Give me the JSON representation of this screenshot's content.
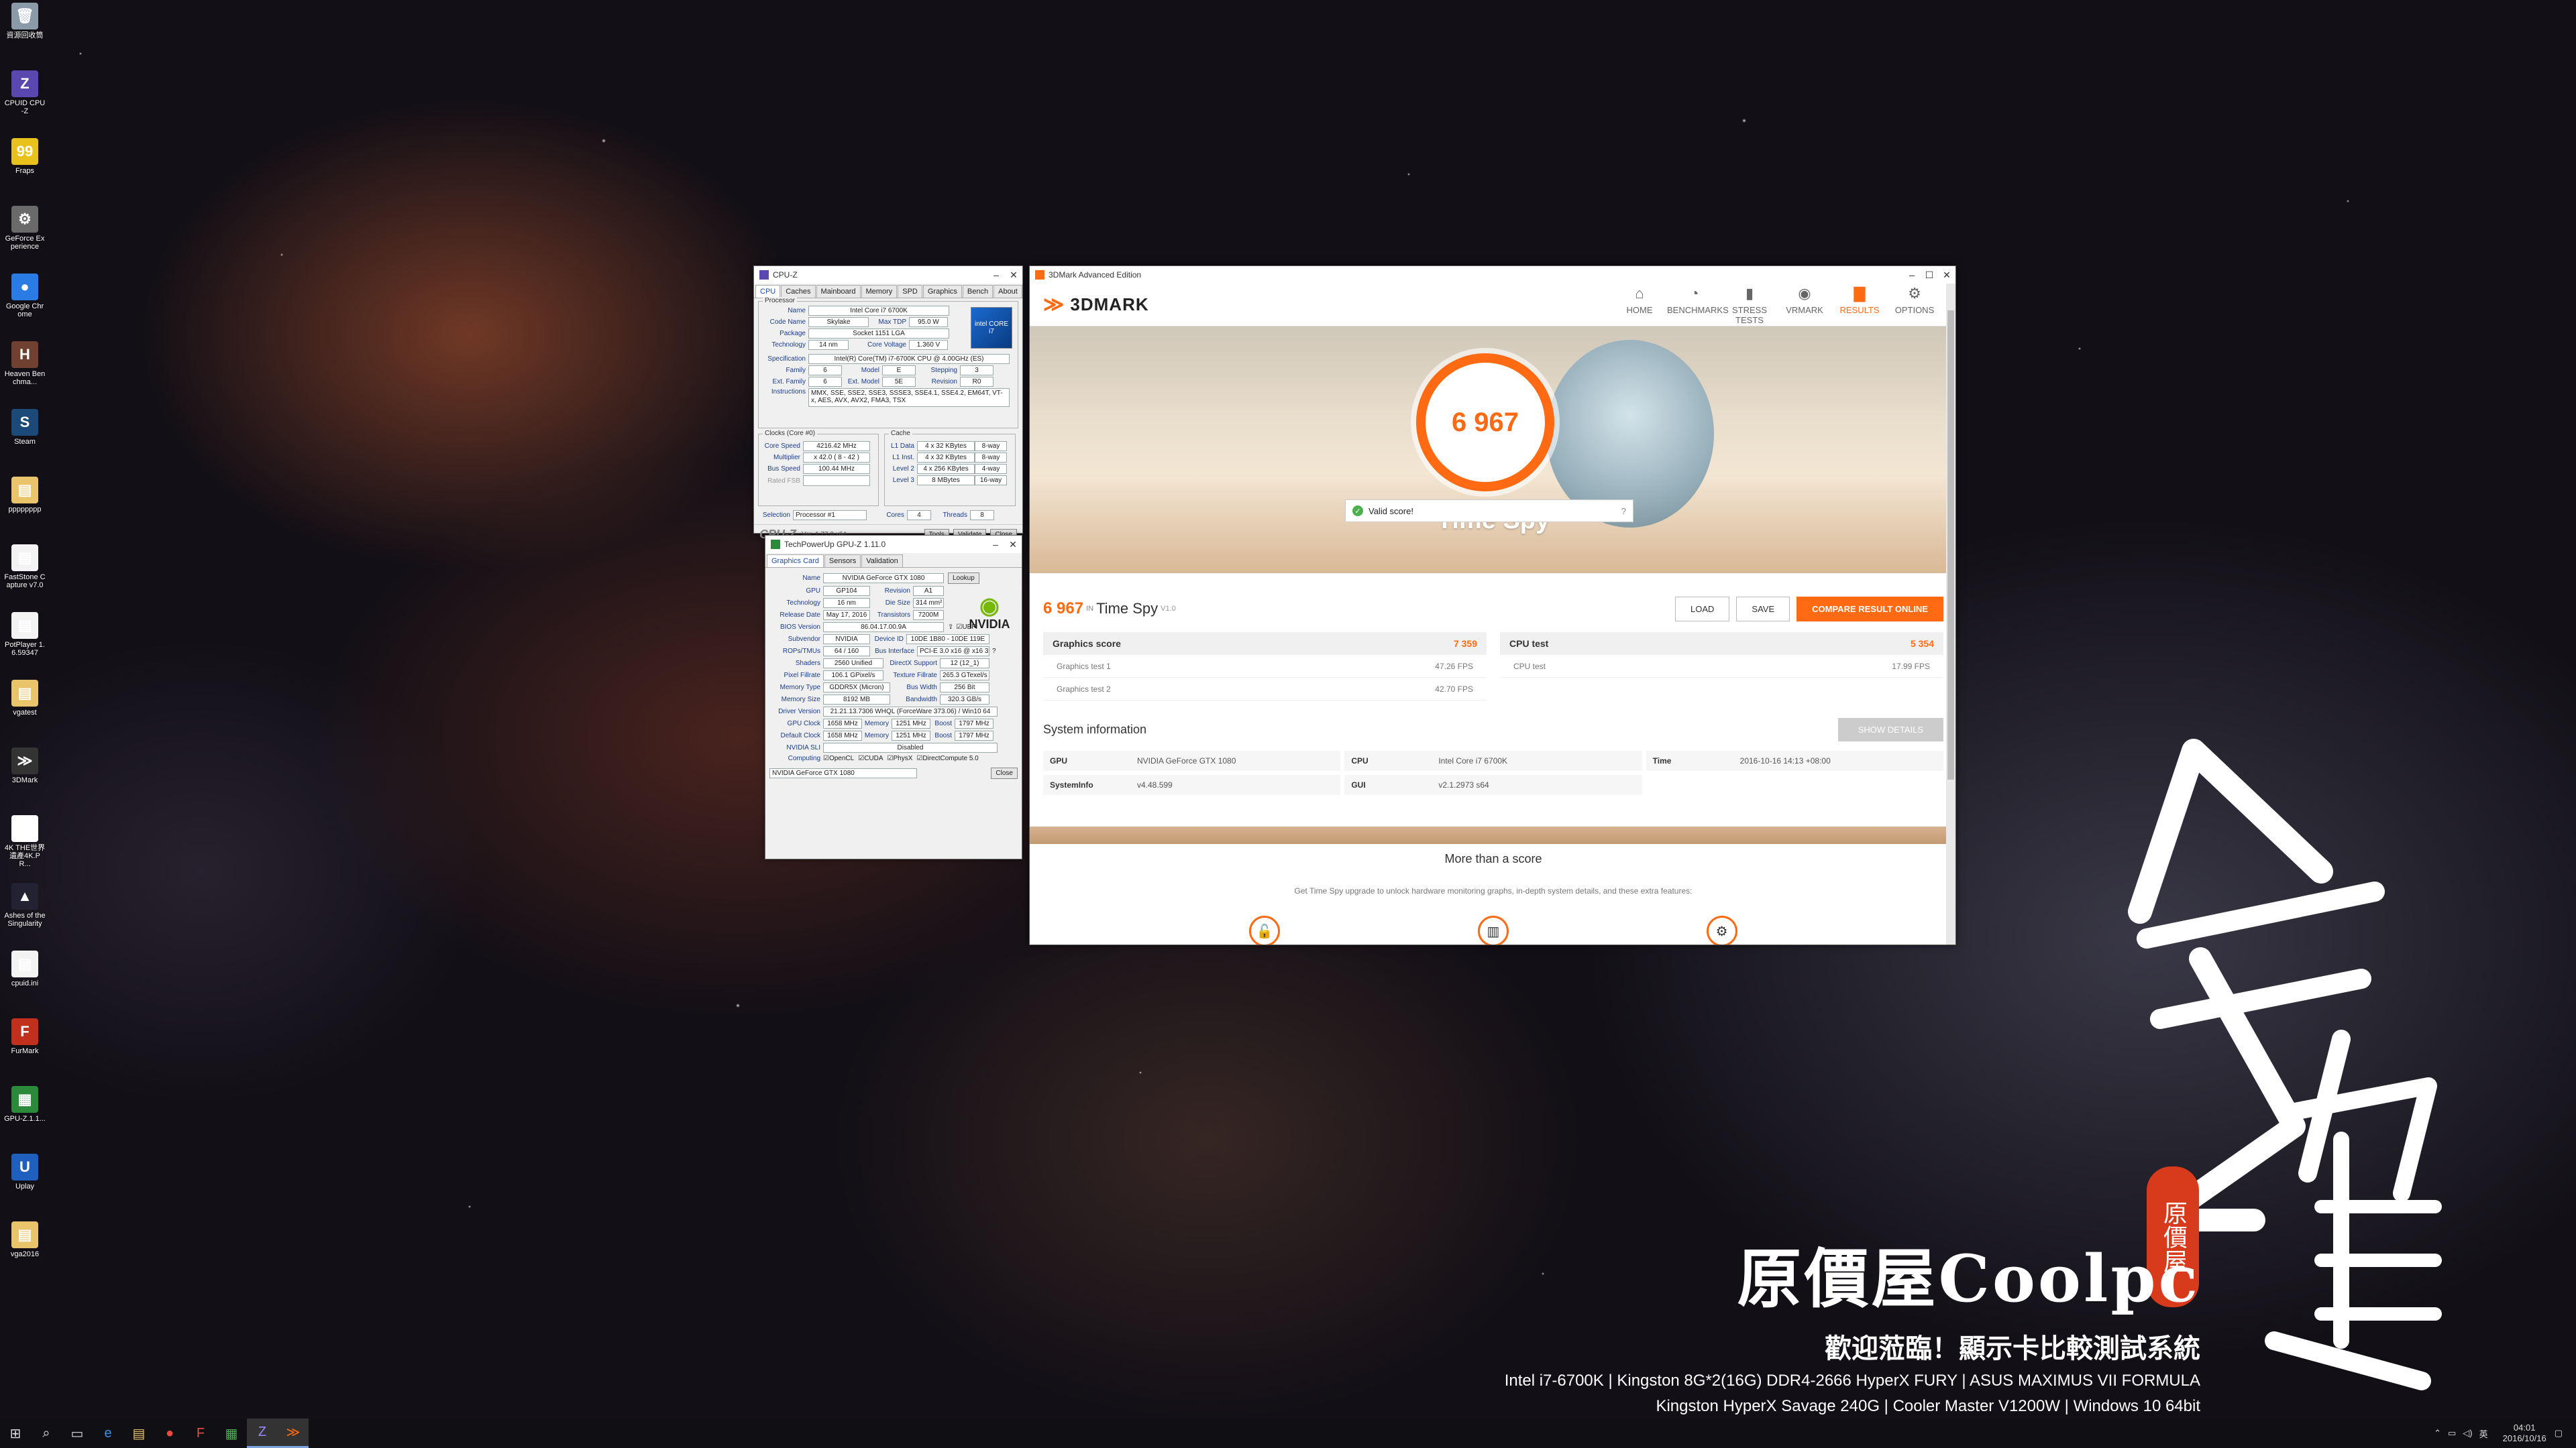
{
  "desktop_icons": [
    {
      "label": "資源回收筒",
      "icon": "recycle-bin-icon",
      "color": "#8a9aa8",
      "glyph": "🗑"
    },
    {
      "label": "CPUID CPU-Z",
      "icon": "cpuz-icon",
      "color": "#5a48b0",
      "glyph": "Z"
    },
    {
      "label": "Fraps",
      "icon": "fraps-icon",
      "color": "#e8c21a",
      "glyph": "99"
    },
    {
      "label": "GeForce Experience",
      "icon": "geforce-icon",
      "color": "#6a6a6a",
      "glyph": "⚙"
    },
    {
      "label": "Google Chrome",
      "icon": "chrome-icon",
      "color": "#2a7be4",
      "glyph": "●"
    },
    {
      "label": "Heaven Benchma...",
      "icon": "heaven-icon",
      "color": "#704030",
      "glyph": "H"
    },
    {
      "label": "Steam",
      "icon": "steam-icon",
      "color": "#1b4a78",
      "glyph": "S"
    },
    {
      "label": "pppppppp",
      "icon": "folder-icon",
      "color": "#e9c46a",
      "glyph": "▤"
    },
    {
      "label": "FastStone Capture v7.0",
      "icon": "file-icon",
      "color": "#f3f3f3",
      "glyph": "▤"
    },
    {
      "label": "PotPlayer 1.6.59347",
      "icon": "file-icon",
      "color": "#f3f3f3",
      "glyph": "▤"
    },
    {
      "label": "vgatest",
      "icon": "folder-icon",
      "color": "#e9c46a",
      "glyph": "▤"
    },
    {
      "label": "3DMark",
      "icon": "3dmark-icon",
      "color": "#333",
      "glyph": "≫"
    },
    {
      "label": "4K THE世界遺產4K.PR...",
      "icon": "document-icon",
      "color": "#ffffff",
      "glyph": "▤"
    },
    {
      "label": "Ashes of the Singularity",
      "icon": "ashes-icon",
      "color": "#223",
      "glyph": "▲"
    },
    {
      "label": "cpuid.ini",
      "icon": "file-icon",
      "color": "#f3f3f3",
      "glyph": "▤"
    },
    {
      "label": "FurMark",
      "icon": "furmark-icon",
      "color": "#c0301c",
      "glyph": "F"
    },
    {
      "label": "GPU-Z.1.1...",
      "icon": "gpuz-icon",
      "color": "#2a8a3a",
      "glyph": "▦"
    },
    {
      "label": "Uplay",
      "icon": "uplay-icon",
      "color": "#1f5fbd",
      "glyph": "U"
    },
    {
      "label": "vga2016",
      "icon": "folder-icon",
      "color": "#e9c46a",
      "glyph": "▤"
    }
  ],
  "cpuz": {
    "title": "CPU-Z",
    "tabs": [
      "CPU",
      "Caches",
      "Mainboard",
      "Memory",
      "SPD",
      "Graphics",
      "Bench",
      "About"
    ],
    "processor_label": "Processor",
    "name_label": "Name",
    "name": "Intel Core i7 6700K",
    "codename_label": "Code Name",
    "codename": "Skylake",
    "maxtdp_label": "Max TDP",
    "maxtdp": "95.0 W",
    "package_label": "Package",
    "package": "Socket 1151 LGA",
    "tech_label": "Technology",
    "tech": "14 nm",
    "corev_label": "Core Voltage",
    "corev": "1.360 V",
    "spec_label": "Specification",
    "spec": "Intel(R) Core(TM) i7-6700K CPU @ 4.00GHz (ES)",
    "family_label": "Family",
    "family": "6",
    "model_label": "Model",
    "model": "E",
    "stepping_label": "Stepping",
    "stepping": "3",
    "extfam_label": "Ext. Family",
    "extfam": "6",
    "extmodel_label": "Ext. Model",
    "extmodel": "5E",
    "revision_label": "Revision",
    "revision": "R0",
    "instr_label": "Instructions",
    "instr": "MMX, SSE, SSE2, SSE3, SSSE3, SSE4.1, SSE4.2, EM64T, VT-x, AES, AVX, AVX2, FMA3, TSX",
    "clocks_label": "Clocks (Core #0)",
    "cache_label": "Cache",
    "corespeed_label": "Core Speed",
    "corespeed": "4216.42 MHz",
    "l1d_label": "L1 Data",
    "l1d": "4 x 32 KBytes",
    "l1d_way": "8-way",
    "mult_label": "Multiplier",
    "mult": "x 42.0 ( 8 - 42 )",
    "l1i_label": "L1 Inst.",
    "l1i": "4 x 32 KBytes",
    "l1i_way": "8-way",
    "bus_label": "Bus Speed",
    "bus": "100.44 MHz",
    "l2_label": "Level 2",
    "l2": "4 x 256 KBytes",
    "l2_way": "4-way",
    "fsb_label": "Rated FSB",
    "l3_label": "Level 3",
    "l3": "8 MBytes",
    "l3_way": "16-way",
    "sel_label": "Selection",
    "sel": "Processor #1",
    "cores_label": "Cores",
    "cores": "4",
    "threads_label": "Threads",
    "threads": "8",
    "footer_brand": "CPU-Z",
    "version": "Ver. 1.77.0.x64",
    "tools": "Tools",
    "validate": "Validate",
    "close": "Close",
    "intel_badge": "intel CORE i7"
  },
  "gpuz": {
    "title": "TechPowerUp GPU-Z 1.11.0",
    "tabs": [
      "Graphics Card",
      "Sensors",
      "Validation"
    ],
    "name_label": "Name",
    "name": "NVIDIA GeForce GTX 1080",
    "lookup": "Lookup",
    "gpu_label": "GPU",
    "gpu": "GP104",
    "rev_label": "Revision",
    "rev": "A1",
    "tech_label": "Technology",
    "tech": "16 nm",
    "die_label": "Die Size",
    "die": "314 mm²",
    "release_label": "Release Date",
    "release": "May 17, 2016",
    "trans_label": "Transistors",
    "trans": "7200M",
    "bios_label": "BIOS Version",
    "bios": "86.04.17.00.9A",
    "uefi": "UEFI",
    "sub_label": "Subvendor",
    "sub": "NVIDIA",
    "devid_label": "Device ID",
    "devid": "10DE 1B80 - 10DE 119E",
    "rops_label": "ROPs/TMUs",
    "rops": "64 / 160",
    "busif_label": "Bus Interface",
    "busif": "PCI-E 3.0 x16 @ x16 3.0",
    "shaders_label": "Shaders",
    "shaders": "2560 Unified",
    "dx_label": "DirectX Support",
    "dx": "12 (12_1)",
    "pixel_label": "Pixel Fillrate",
    "pixel": "106.1 GPixel/s",
    "tex_label": "Texture Fillrate",
    "tex": "265.3 GTexel/s",
    "memtype_label": "Memory Type",
    "memtype": "GDDR5X (Micron)",
    "busw_label": "Bus Width",
    "busw": "256 Bit",
    "memsize_label": "Memory Size",
    "memsize": "8192 MB",
    "bw_label": "Bandwidth",
    "bw": "320.3 GB/s",
    "driver_label": "Driver Version",
    "driver": "21.21.13.7306 WHQL (ForceWare 373.06) / Win10 64",
    "gpuclk_label": "GPU Clock",
    "gpuclk": "1658 MHz",
    "mem_label": "Memory",
    "mem": "1251 MHz",
    "boost_label": "Boost",
    "boost": "1797 MHz",
    "defclk_label": "Default Clock",
    "defclk": "1658 MHz",
    "defmem": "1251 MHz",
    "defboost": "1797 MHz",
    "sli_label": "NVIDIA SLI",
    "sli": "Disabled",
    "computing_label": "Computing",
    "opencl": "OpenCL",
    "cuda": "CUDA",
    "physx": "PhysX",
    "dc": "DirectCompute 5.0",
    "select": "NVIDIA GeForce GTX 1080",
    "close": "Close",
    "nvidia": "NVIDIA"
  },
  "dmark": {
    "title": "3DMark Advanced Edition",
    "logo": "3DMARK",
    "nav": [
      {
        "label": "HOME",
        "glyph": "⌂",
        "name": "nav-home"
      },
      {
        "label": "BENCHMARKS",
        "glyph": "◔",
        "name": "nav-benchmarks"
      },
      {
        "label": "STRESS TESTS",
        "glyph": "▮",
        "name": "nav-stress-tests"
      },
      {
        "label": "VRMARK",
        "glyph": "◉",
        "name": "nav-vrmark"
      },
      {
        "label": "RESULTS",
        "glyph": "▇",
        "name": "nav-results"
      },
      {
        "label": "OPTIONS",
        "glyph": "⚙",
        "name": "nav-options"
      }
    ],
    "score": "6 967",
    "test": "Time Spy",
    "valid": "Valid score!",
    "res_score": "6 967",
    "res_in": "IN",
    "res_test": "Time Spy",
    "res_ver": "V1.0",
    "load": "LOAD",
    "save": "SAVE",
    "compare": "COMPARE RESULT ONLINE",
    "graphics_label": "Graphics score",
    "graphics": "7 359",
    "gt1_label": "Graphics test 1",
    "gt1": "47.26 FPS",
    "gt2_label": "Graphics test 2",
    "gt2": "42.70 FPS",
    "cpu_label": "CPU test",
    "cpu": "5 354",
    "cput_label": "CPU test",
    "cput": "17.99 FPS",
    "sysinfo": "System information",
    "showdetails": "SHOW DETAILS",
    "gpu_k": "GPU",
    "gpu_v": "NVIDIA GeForce GTX 1080",
    "cpu_k": "CPU",
    "cpu_v": "Intel Core i7 6700K",
    "time_k": "Time",
    "time_v": "2016-10-16 14:13 +08:00",
    "si_k": "SystemInfo",
    "si_v": "v4.48.599",
    "gui_k": "GUI",
    "gui_v": "v2.1.2973 s64",
    "more_title": "More than a score",
    "more_text": "Get Time Spy upgrade to unlock hardware monitoring graphs, in-depth system details, and these extra features:"
  },
  "branding": {
    "logo": "原價屋Coolpc",
    "welcome": "歡迎蒞臨！顯示卡比較測試系統",
    "spec1": "Intel i7-6700K | Kingston 8G*2(16G) DDR4-2666 HyperX FURY | ASUS MAXIMUS VII FORMULA",
    "spec2": "Kingston HyperX Savage 240G | Cooler Master V1200W | Windows 10 64bit",
    "seal": "原價屋",
    "callig": "金雙"
  },
  "taskbar": {
    "clock_time": "04:01",
    "clock_date": "2016/10/16"
  }
}
